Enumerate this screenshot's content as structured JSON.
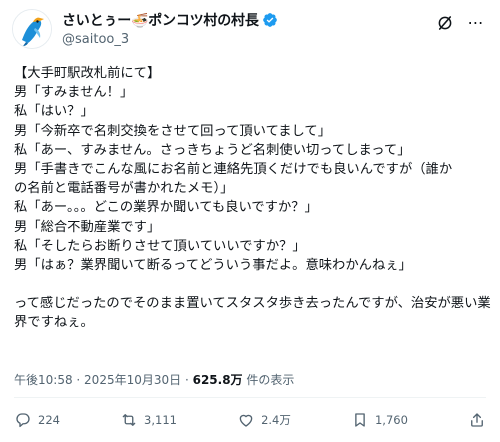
{
  "author": {
    "display_name": "さいとぅー🍜ポンコツ村の村長",
    "handle": "@saitoo_3",
    "verified": true,
    "avatar_icon": "bird-avatar-icon"
  },
  "post": {
    "lines": [
      "【大手町駅改札前にて】",
      "男「すみません！」",
      "私「はい？」",
      "男「今新卒で名刺交換をさせて回って頂いてまして」",
      "私「あー、すみません。さっきちょうど名刺使い切ってしまって」",
      "男「手書きでこんな風にお名前と連絡先頂くだけでも良いんですが（誰か",
      "の名前と電話番号が書かれたメモ）」",
      "私「あー。。。どこの業界か聞いても良いですか？」",
      "男「総合不動産業です」",
      "私「そしたらお断りさせて頂いていいですか？」",
      "男「はぁ？業界聞いて断るってどういう事だよ。意味わかんねぇ」"
    ],
    "closing": "って感じだったのでそのまま置いてスタスタ歩き去ったんですが、治安が悪い業界ですねぇ。"
  },
  "meta": {
    "time": "午後10:58",
    "separator": " · ",
    "date": "2025年10月30日",
    "views": "625.8万",
    "views_label": " 件の表示"
  },
  "actions": {
    "replies": "224",
    "reposts": "3,111",
    "likes": "2.4万",
    "bookmarks": "1,760"
  },
  "colors": {
    "text": "#0f1419",
    "secondary": "#536471",
    "verified": "#1d9bf0",
    "divider": "#eff3f4"
  }
}
